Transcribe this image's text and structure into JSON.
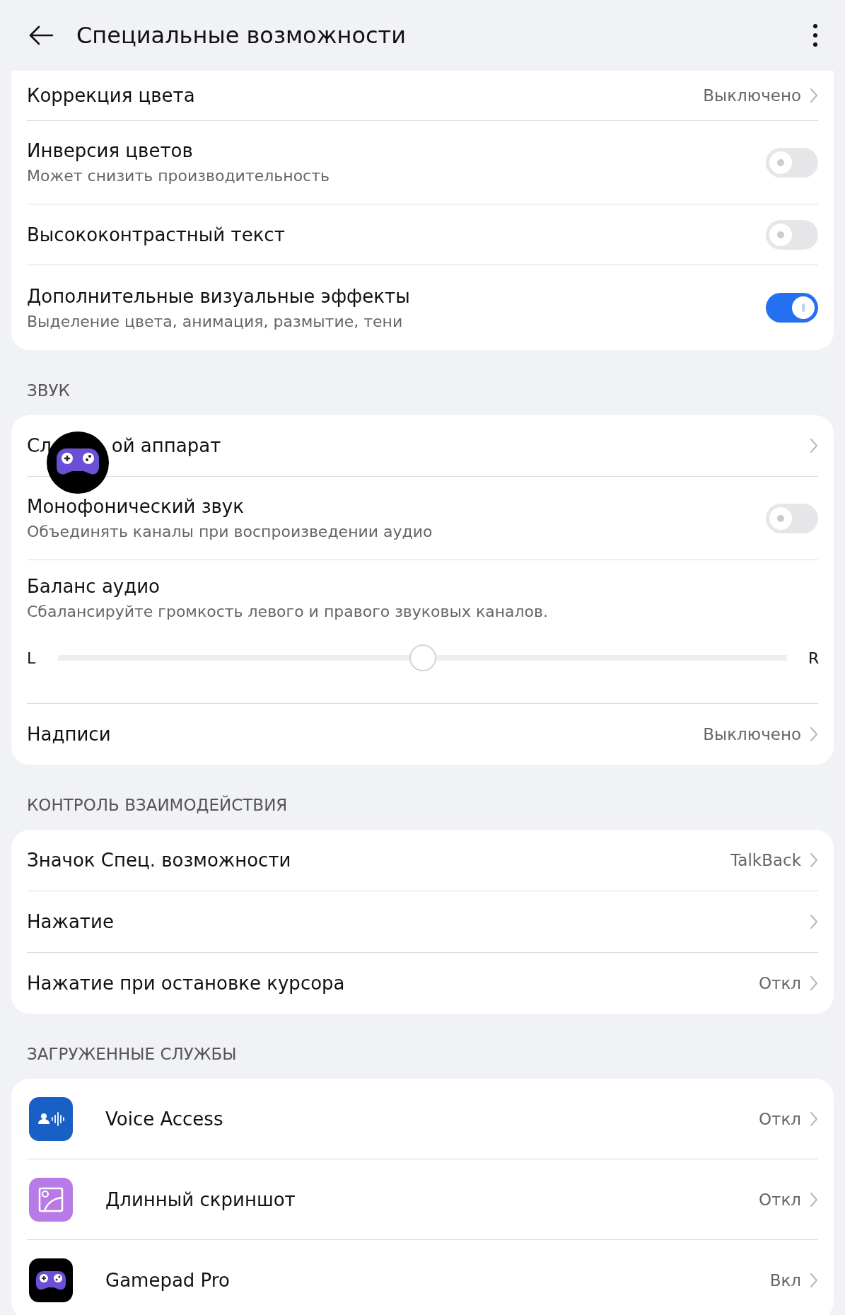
{
  "header": {
    "title": "Специальные возможности"
  },
  "sections": [
    {
      "items": [
        {
          "kind": "link",
          "title": "Коррекция цвета",
          "value": "Выключено"
        },
        {
          "kind": "toggle",
          "title": "Инверсия цветов",
          "subtitle": "Может снизить производительность",
          "on": false
        },
        {
          "kind": "toggle",
          "title": "Высококонтрастный текст",
          "on": false
        },
        {
          "kind": "toggle",
          "title": "Дополнительные визуальные эффекты",
          "subtitle": "Выделение цвета, анимация, размытие, тени",
          "on": true
        }
      ]
    },
    {
      "heading": "ЗВУК",
      "items": [
        {
          "kind": "link",
          "title_parts": [
            "Сл",
            "ой аппарат"
          ]
        },
        {
          "kind": "toggle",
          "title": "Монофонический звук",
          "subtitle": "Объединять каналы при воспроизведении аудио",
          "on": false
        },
        {
          "kind": "slider",
          "title": "Баланс аудио",
          "subtitle": "Сбалансируйте громкость левого и правого звуковых каналов.",
          "left": "L",
          "right": "R",
          "level": 0.5
        },
        {
          "kind": "link",
          "title": "Надписи",
          "value": "Выключено"
        }
      ]
    },
    {
      "heading": "КОНТРОЛЬ ВЗАИМОДЕЙСТВИЯ",
      "items": [
        {
          "kind": "link",
          "title": "Значок Спец. возможности",
          "value": "TalkBack"
        },
        {
          "kind": "link",
          "title": "Нажатие"
        },
        {
          "kind": "link",
          "title": "Нажатие при остановке курсора",
          "value": "Откл"
        }
      ]
    },
    {
      "heading": "ЗАГРУЖЕННЫЕ СЛУЖБЫ",
      "items": [
        {
          "kind": "app",
          "title": "Voice Access",
          "value": "Откл"
        },
        {
          "kind": "app",
          "title": "Длинный скриншот",
          "value": "Откл"
        },
        {
          "kind": "app",
          "title": "Gamepad Pro",
          "value": "Вкл"
        }
      ]
    }
  ]
}
